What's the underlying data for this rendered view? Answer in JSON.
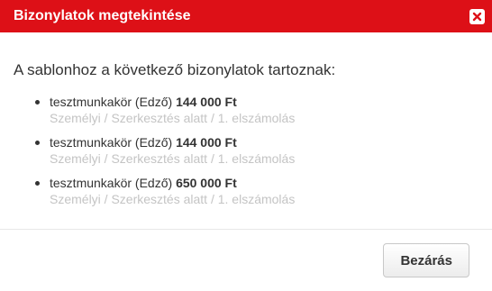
{
  "dialog": {
    "title": "Bizonylatok megtekintése",
    "close_icon": "close-icon",
    "accent_color": "#dd1017"
  },
  "content": {
    "intro": "A sablonhoz a következő bizonylatok tartoznak:",
    "items": [
      {
        "name": "tesztmunkakör (Edző)",
        "amount": "144 000 Ft",
        "details": "Személyi / Szerkesztés alatt / 1. elszámolás"
      },
      {
        "name": "tesztmunkakör (Edző)",
        "amount": "144 000 Ft",
        "details": "Személyi / Szerkesztés alatt / 1. elszámolás"
      },
      {
        "name": "tesztmunkakör (Edző)",
        "amount": "650 000 Ft",
        "details": "Személyi / Szerkesztés alatt / 1. elszámolás"
      }
    ]
  },
  "footer": {
    "close_label": "Bezárás"
  }
}
